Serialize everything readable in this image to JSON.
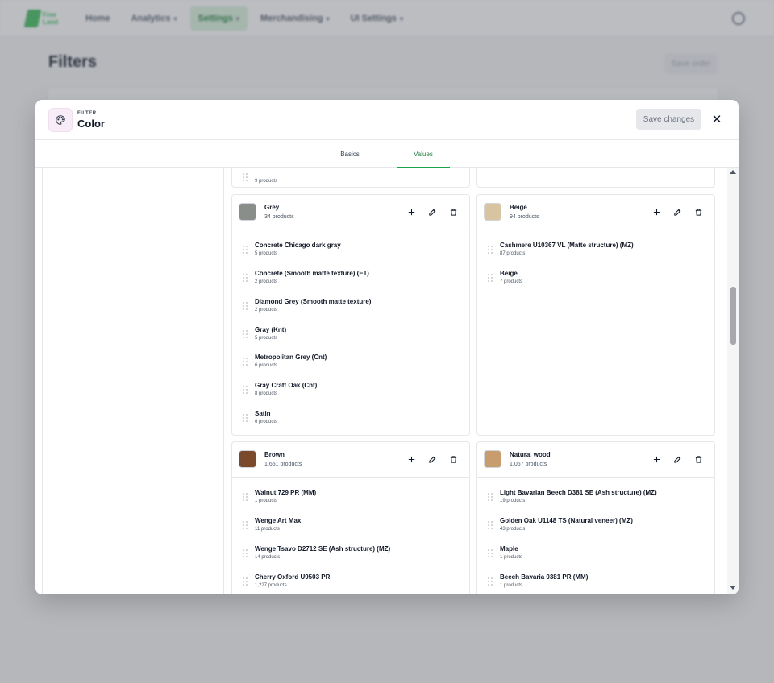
{
  "nav": {
    "logo_text": "Free\nLand",
    "items": [
      {
        "label": "Home",
        "dropdown": false,
        "active": false
      },
      {
        "label": "Analytics",
        "dropdown": true,
        "active": false
      },
      {
        "label": "Settings",
        "dropdown": true,
        "active": true
      },
      {
        "label": "Merchandising",
        "dropdown": true,
        "active": false
      },
      {
        "label": "UI Settings",
        "dropdown": true,
        "active": false
      }
    ]
  },
  "background": {
    "page_title": "Filters",
    "save_order_label": "Save order"
  },
  "modal": {
    "kicker": "FILTER",
    "title": "Color",
    "save_label": "Save changes",
    "tabs": [
      {
        "label": "Basics",
        "active": false
      },
      {
        "label": "Values",
        "active": true
      }
    ],
    "top_partial_item": {
      "name": "",
      "count": "9 products"
    },
    "groups": [
      {
        "name": "Grey",
        "count": "34 products",
        "color": "#8a8e8a",
        "items": [
          {
            "name": "Concrete Chicago dark gray",
            "count": "5 products"
          },
          {
            "name": "Concrete (Smooth matte texture) (E1)",
            "count": "2 products"
          },
          {
            "name": "Diamond Grey (Smooth matte texture)",
            "count": "2 products"
          },
          {
            "name": "Gray (Knt)",
            "count": "5 products"
          },
          {
            "name": "Metropolitan Grey (Cnt)",
            "count": "6 products"
          },
          {
            "name": "Gray Craft Oak (Cnt)",
            "count": "8 products"
          },
          {
            "name": "Satin",
            "count": "6 products"
          }
        ]
      },
      {
        "name": "Beige",
        "count": "94 products",
        "color": "#d8c4a0",
        "items": [
          {
            "name": "Cashmere U10367 VL (Matte structure) (MZ)",
            "count": "87 products"
          },
          {
            "name": "Beige",
            "count": "7 products"
          }
        ]
      },
      {
        "name": "Brown",
        "count": "1,651 products",
        "color": "#7a4a2a",
        "items": [
          {
            "name": "Walnut 729 PR (MM)",
            "count": "1 products"
          },
          {
            "name": "Wenge Art Max",
            "count": "11 products"
          },
          {
            "name": "Wenge Tsavo D2712 SE (Ash structure) (MZ)",
            "count": "14 products"
          },
          {
            "name": "Cherry Oxford U9503 PR",
            "count": "1,227 products"
          }
        ]
      },
      {
        "name": "Natural wood",
        "count": "1,067 products",
        "color": "#c89d6e",
        "items": [
          {
            "name": "Light Bavarian Beech D381 SE (Ash structure) (MZ)",
            "count": "19 products"
          },
          {
            "name": "Golden Oak U1148 TS (Natural veneer) (MZ)",
            "count": "43 products"
          },
          {
            "name": "Maple",
            "count": "1 products"
          },
          {
            "name": "Beech Bavaria 0381 PR (MM)",
            "count": "1 products"
          }
        ]
      }
    ]
  },
  "icons": {
    "filter": "palette-icon",
    "close": "close-icon",
    "add": "plus-icon",
    "edit": "pencil-icon",
    "delete": "trash-icon",
    "drag": "drag-handle-icon"
  }
}
